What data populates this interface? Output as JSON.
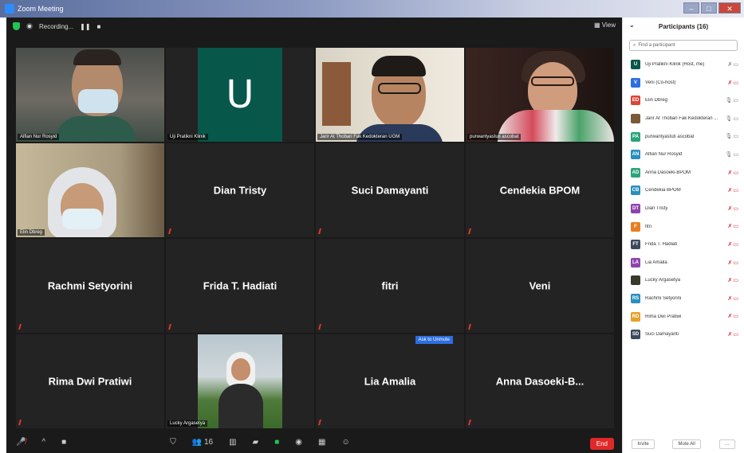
{
  "window": {
    "title": "Zoom Meeting"
  },
  "topbar": {
    "recording_label": "Recording...",
    "view_label": "View"
  },
  "tiles": [
    {
      "caption": "Alfian Nur Rosyid"
    },
    {
      "caption": "Uji Pratikni Klinik",
      "letter": "U"
    },
    {
      "caption": "Jarir At Thobari Fak Kedokteran UGM"
    },
    {
      "caption": "purwantyastuti ascobat"
    },
    {
      "caption": "Elin Dbreg"
    },
    {
      "name": "Dian Tristy"
    },
    {
      "name": "Suci Damayanti"
    },
    {
      "name": "Cendekia  BPOM"
    },
    {
      "name": "Rachmi Setyorini"
    },
    {
      "name": "Frida T. Hadiati"
    },
    {
      "name": "fitri"
    },
    {
      "name": "Veni"
    },
    {
      "name": "Rima Dwi Pratiwi"
    },
    {
      "caption": "Lucky Argasetya"
    },
    {
      "name": "Lia Amalia",
      "ask_unmute": "Ask to Unmute"
    },
    {
      "name": "Anna  Dasoeki-B..."
    }
  ],
  "bottombar": {
    "participants_count": "16",
    "end_label": "End"
  },
  "panel": {
    "title": "Participants (16)",
    "search_placeholder": "Find a participant",
    "participants": [
      {
        "initials": "U",
        "name": "Uji Pratikni Klinik (Host, me)",
        "color": "#07574a"
      },
      {
        "initials": "V",
        "name": "Veni (Co-host)",
        "color": "#2d6ee0"
      },
      {
        "initials": "ED",
        "name": "Elin Dbreg",
        "color": "#d8473a"
      },
      {
        "initials": "",
        "name": "Jarir At Thobari Fak Kedokteran ...",
        "color": "#7a5a3a"
      },
      {
        "initials": "PA",
        "name": "purwantyastuti ascobat",
        "color": "#2aa37a"
      },
      {
        "initials": "AN",
        "name": "Alfian Nur Rosyid",
        "color": "#2a8fbd"
      },
      {
        "initials": "AD",
        "name": "Anna Dasoeki-BPOM",
        "color": "#2aa37a"
      },
      {
        "initials": "CB",
        "name": "Cendekia  BPOM",
        "color": "#2a8fbd"
      },
      {
        "initials": "DT",
        "name": "Dian Tristy",
        "color": "#8e44ad"
      },
      {
        "initials": "F",
        "name": "fitri",
        "color": "#e67e22"
      },
      {
        "initials": "FT",
        "name": "Frida T. Hadiati",
        "color": "#3b4a5a"
      },
      {
        "initials": "LA",
        "name": "Lia Amalia",
        "color": "#8e44ad"
      },
      {
        "initials": "",
        "name": "Lucky Argasetya",
        "color": "#3a3a2a"
      },
      {
        "initials": "RS",
        "name": "Rachmi Setyorini",
        "color": "#2a8fbd"
      },
      {
        "initials": "RD",
        "name": "Rima Dwi Pratiwi",
        "color": "#e6a02a"
      },
      {
        "initials": "SD",
        "name": "Suci Damayanti",
        "color": "#3b4a5a"
      }
    ],
    "footer": {
      "invite": "Invite",
      "mute_all": "Mute All"
    }
  }
}
